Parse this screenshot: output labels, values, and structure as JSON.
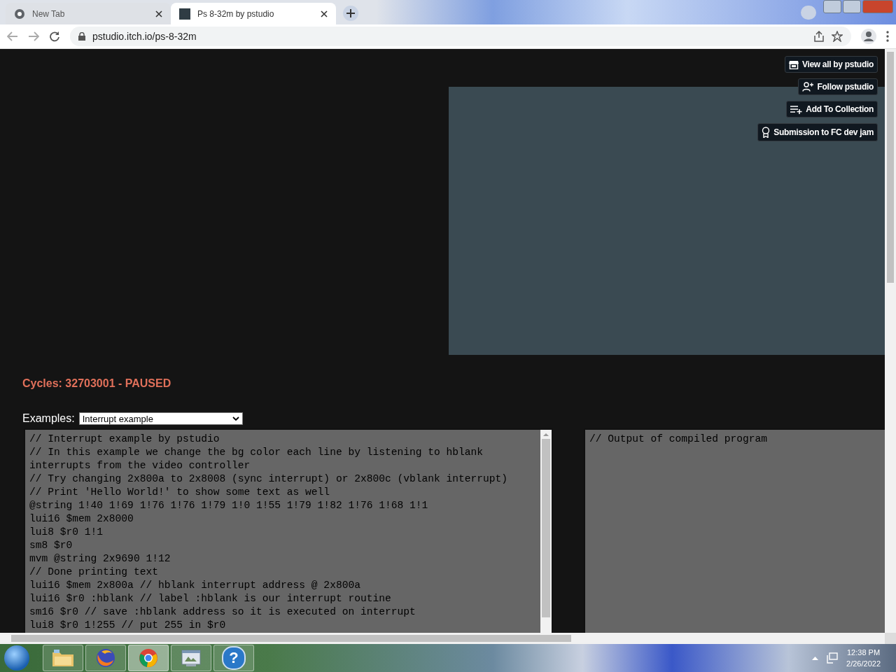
{
  "browser": {
    "tabs": [
      {
        "title": "New Tab",
        "kind": "newtab",
        "selected": false
      },
      {
        "title": "Ps 8-32m by pstudio",
        "kind": "page",
        "selected": true
      }
    ],
    "url": "pstudio.itch.io/ps-8-32m"
  },
  "page": {
    "buttons": [
      {
        "label": "View all by pstudio",
        "kind": "store"
      },
      {
        "label": "Follow pstudio",
        "kind": "follow"
      },
      {
        "label": "Add To Collection",
        "kind": "collection"
      },
      {
        "label": "Submission to FC dev jam",
        "kind": "award"
      }
    ],
    "status": "Cycles: 32703001 - PAUSED",
    "examples_label": "Examples:",
    "examples_select": {
      "value": "Interrupt example"
    },
    "editor_lines": [
      "// Interrupt example by pstudio",
      "// In this example we change the bg color each line by listening to hblank",
      "interrupts from the video controller",
      "// Try changing 2x800a to 2x8008 (sync interrupt) or 2x800c (vblank interrupt)",
      "// Print 'Hello World!' to show some text as well",
      "@string 1!40 1!69 1!76 1!76 1!79 1!0 1!55 1!79 1!82 1!76 1!68 1!1",
      "lui16 $mem 2x8000",
      "lui8 $r0 1!1",
      "sm8 $r0",
      "mvm @string 2x9690 1!12",
      "// Done printing text",
      "lui16 $mem 2x800a // hblank interrupt address @ 2x800a",
      "lui16 $r0 :hblank // label :hblank is our interrupt routine",
      "sm16 $r0 // save :hblank address so it is executed on interrupt",
      "lui8 $r0 1!255 // put 255 in $r0"
    ],
    "output_lines": [
      "// Output of compiled program"
    ]
  },
  "taskbar": {
    "apps": [
      {
        "kind": "folder",
        "selected": false
      },
      {
        "kind": "firefox",
        "selected": false
      },
      {
        "kind": "chrome",
        "selected": true
      },
      {
        "kind": "window",
        "selected": false
      },
      {
        "kind": "help",
        "label": "?",
        "selected": false
      }
    ],
    "time": "12:38 PM",
    "date": "2/26/2022"
  }
}
